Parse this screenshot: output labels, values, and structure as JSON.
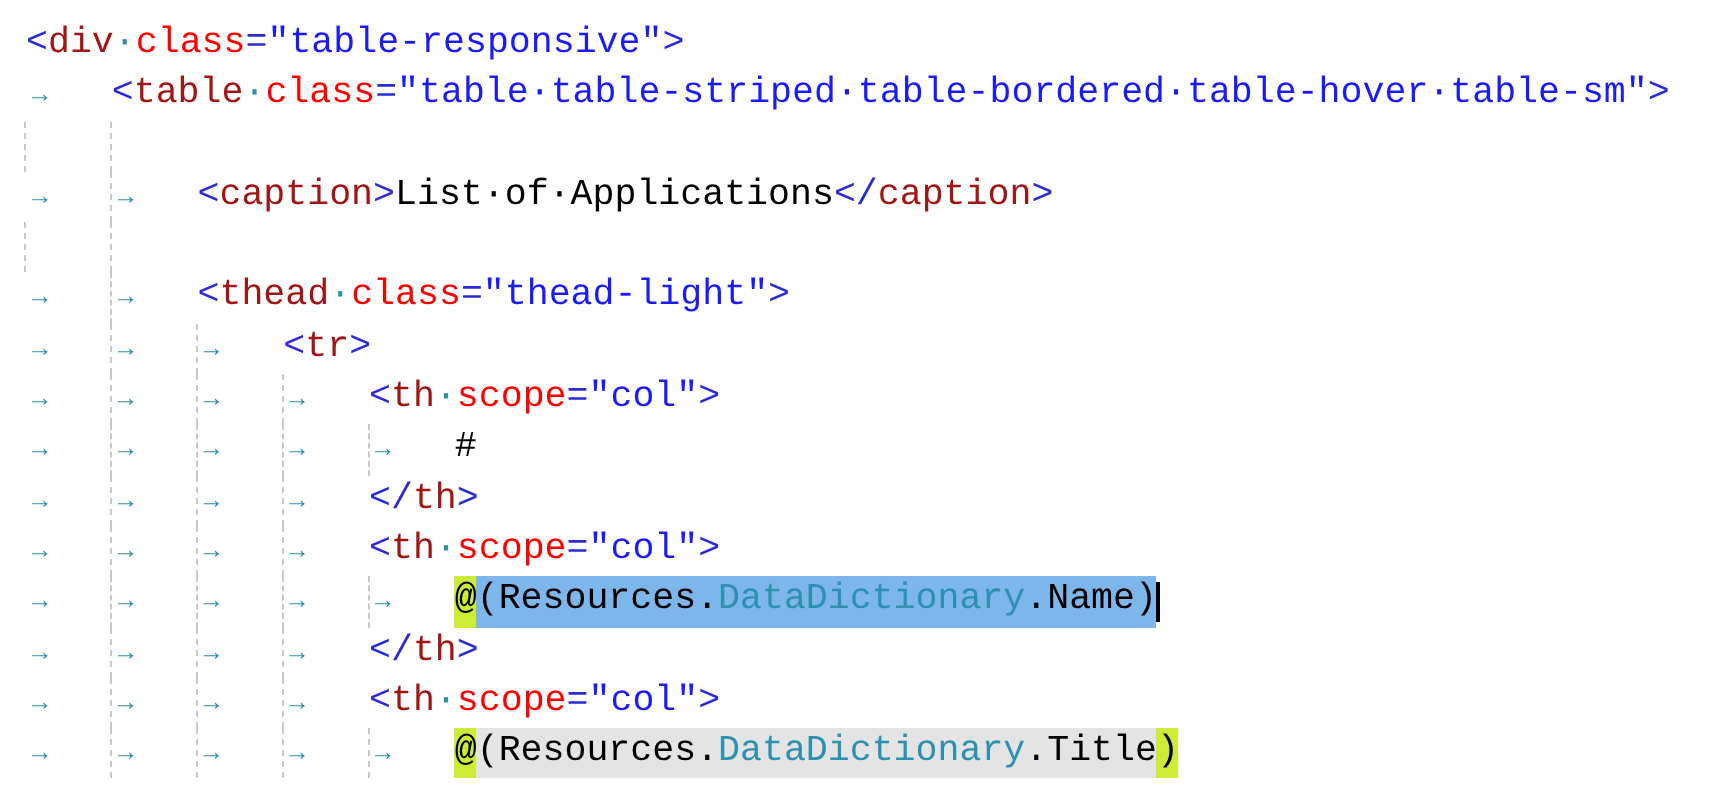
{
  "editor": {
    "lines": [
      {
        "tokens": [
          {
            "kind": "punct",
            "text": "<"
          },
          {
            "kind": "tag",
            "text": "div"
          },
          {
            "kind": "ws",
            "text": "·"
          },
          {
            "kind": "attr",
            "text": "class"
          },
          {
            "kind": "punct",
            "text": "="
          },
          {
            "kind": "value",
            "text": "\"table-responsive\""
          },
          {
            "kind": "punct",
            "text": ">"
          }
        ]
      },
      {
        "tokens": [
          {
            "kind": "tab",
            "text": "→"
          },
          {
            "kind": "punct",
            "text": "<"
          },
          {
            "kind": "tag",
            "text": "table"
          },
          {
            "kind": "ws",
            "text": "·"
          },
          {
            "kind": "attr",
            "text": "class"
          },
          {
            "kind": "punct",
            "text": "="
          },
          {
            "kind": "value",
            "text": "\"table·table-striped·table-bordered·table-hover·table-sm\""
          },
          {
            "kind": "punct",
            "text": ">"
          }
        ]
      },
      {
        "blank_line_before": true,
        "tokens": [
          {
            "kind": "tab",
            "text": "→"
          },
          {
            "kind": "tab",
            "text": "→"
          },
          {
            "kind": "punct",
            "text": "<"
          },
          {
            "kind": "tag",
            "text": "caption"
          },
          {
            "kind": "punct",
            "text": ">"
          },
          {
            "kind": "text",
            "text": "List·of·Applications"
          },
          {
            "kind": "punct",
            "text": "</"
          },
          {
            "kind": "tag",
            "text": "caption"
          },
          {
            "kind": "punct",
            "text": ">"
          }
        ]
      },
      {
        "blank_line_before": true,
        "tokens": [
          {
            "kind": "tab",
            "text": "→"
          },
          {
            "kind": "tab",
            "text": "→"
          },
          {
            "kind": "punct",
            "text": "<"
          },
          {
            "kind": "tag",
            "text": "thead"
          },
          {
            "kind": "ws",
            "text": "·"
          },
          {
            "kind": "attr",
            "text": "class"
          },
          {
            "kind": "punct",
            "text": "="
          },
          {
            "kind": "value",
            "text": "\"thead-light\""
          },
          {
            "kind": "punct",
            "text": ">"
          }
        ]
      },
      {
        "tokens": [
          {
            "kind": "tab",
            "text": "→"
          },
          {
            "kind": "tab",
            "text": "→"
          },
          {
            "kind": "tab",
            "text": "→"
          },
          {
            "kind": "punct",
            "text": "<"
          },
          {
            "kind": "tag",
            "text": "tr"
          },
          {
            "kind": "punct",
            "text": ">"
          }
        ]
      },
      {
        "tokens": [
          {
            "kind": "tab",
            "text": "→"
          },
          {
            "kind": "tab",
            "text": "→"
          },
          {
            "kind": "tab",
            "text": "→"
          },
          {
            "kind": "tab",
            "text": "→"
          },
          {
            "kind": "punct",
            "text": "<"
          },
          {
            "kind": "tag",
            "text": "th"
          },
          {
            "kind": "ws",
            "text": "·"
          },
          {
            "kind": "attr",
            "text": "scope"
          },
          {
            "kind": "punct",
            "text": "="
          },
          {
            "kind": "value",
            "text": "\"col\""
          },
          {
            "kind": "punct",
            "text": ">"
          }
        ]
      },
      {
        "tokens": [
          {
            "kind": "tab",
            "text": "→"
          },
          {
            "kind": "tab",
            "text": "→"
          },
          {
            "kind": "tab",
            "text": "→"
          },
          {
            "kind": "tab",
            "text": "→"
          },
          {
            "kind": "tab",
            "text": "→"
          },
          {
            "kind": "text",
            "text": "#"
          }
        ]
      },
      {
        "tokens": [
          {
            "kind": "tab",
            "text": "→"
          },
          {
            "kind": "tab",
            "text": "→"
          },
          {
            "kind": "tab",
            "text": "→"
          },
          {
            "kind": "tab",
            "text": "→"
          },
          {
            "kind": "punct",
            "text": "</"
          },
          {
            "kind": "tag",
            "text": "th"
          },
          {
            "kind": "punct",
            "text": ">"
          }
        ]
      },
      {
        "tokens": [
          {
            "kind": "tab",
            "text": "→"
          },
          {
            "kind": "tab",
            "text": "→"
          },
          {
            "kind": "tab",
            "text": "→"
          },
          {
            "kind": "tab",
            "text": "→"
          },
          {
            "kind": "punct",
            "text": "<"
          },
          {
            "kind": "tag",
            "text": "th"
          },
          {
            "kind": "ws",
            "text": "·"
          },
          {
            "kind": "attr",
            "text": "scope"
          },
          {
            "kind": "punct",
            "text": "="
          },
          {
            "kind": "value",
            "text": "\"col\""
          },
          {
            "kind": "punct",
            "text": ">"
          }
        ]
      },
      {
        "caret": true,
        "tokens": [
          {
            "kind": "tab",
            "text": "→"
          },
          {
            "kind": "tab",
            "text": "→"
          },
          {
            "kind": "tab",
            "text": "→"
          },
          {
            "kind": "tab",
            "text": "→"
          },
          {
            "kind": "tab",
            "text": "→"
          },
          {
            "kind": "text",
            "text": "@",
            "brace_matched": true
          },
          {
            "kind": "text",
            "text": "(Resources.",
            "selected": true
          },
          {
            "kind": "type",
            "text": "DataDictionary",
            "selected": true
          },
          {
            "kind": "text",
            "text": ".Name)",
            "selected": true
          }
        ]
      },
      {
        "tokens": [
          {
            "kind": "tab",
            "text": "→"
          },
          {
            "kind": "tab",
            "text": "→"
          },
          {
            "kind": "tab",
            "text": "→"
          },
          {
            "kind": "tab",
            "text": "→"
          },
          {
            "kind": "punct",
            "text": "</"
          },
          {
            "kind": "tag",
            "text": "th"
          },
          {
            "kind": "punct",
            "text": ">"
          }
        ]
      },
      {
        "tokens": [
          {
            "kind": "tab",
            "text": "→"
          },
          {
            "kind": "tab",
            "text": "→"
          },
          {
            "kind": "tab",
            "text": "→"
          },
          {
            "kind": "tab",
            "text": "→"
          },
          {
            "kind": "punct",
            "text": "<"
          },
          {
            "kind": "tag",
            "text": "th"
          },
          {
            "kind": "ws",
            "text": "·"
          },
          {
            "kind": "attr",
            "text": "scope"
          },
          {
            "kind": "punct",
            "text": "="
          },
          {
            "kind": "value",
            "text": "\"col\""
          },
          {
            "kind": "punct",
            "text": ">"
          }
        ]
      },
      {
        "tokens": [
          {
            "kind": "tab",
            "text": "→"
          },
          {
            "kind": "tab",
            "text": "→"
          },
          {
            "kind": "tab",
            "text": "→"
          },
          {
            "kind": "tab",
            "text": "→"
          },
          {
            "kind": "tab",
            "text": "→"
          },
          {
            "kind": "text",
            "text": "@",
            "brace_matched": true
          },
          {
            "kind": "text",
            "text": "(Resources.",
            "reference_highlighted": true
          },
          {
            "kind": "type",
            "text": "DataDictionary",
            "reference_highlighted": true
          },
          {
            "kind": "text",
            "text": ".Title",
            "reference_highlighted": true
          },
          {
            "kind": "text",
            "text": ")",
            "brace_matched": true
          }
        ]
      }
    ]
  }
}
